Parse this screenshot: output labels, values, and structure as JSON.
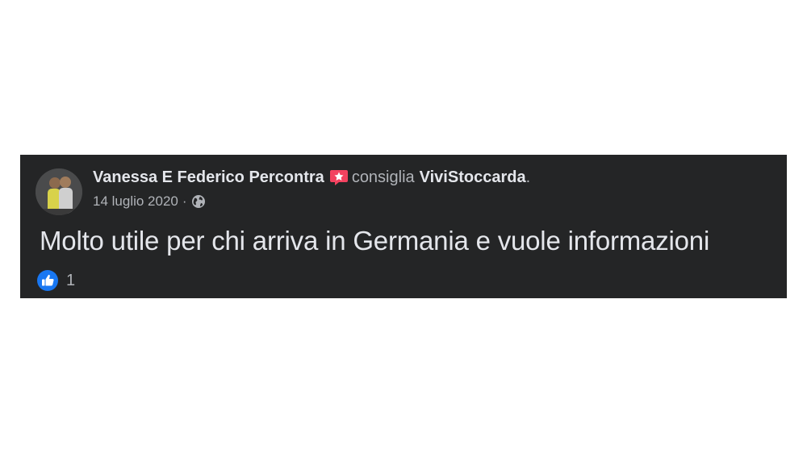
{
  "post": {
    "author": "Vanessa E Federico Percontra",
    "verb": "consiglia",
    "page_name": "ViviStoccarda",
    "period": ".",
    "date": "14 luglio 2020",
    "separator": "·",
    "text": "Molto utile per chi arriva in Germania e vuole informazioni",
    "reaction_count": "1"
  },
  "icons": {
    "recommend": "recommend-star-icon",
    "audience": "globe-icon",
    "reaction": "like-icon"
  },
  "colors": {
    "card_background": "#242526",
    "primary_text": "#e4e6eb",
    "secondary_text": "#b0b3b8",
    "recommend_badge": "#f3425f",
    "like_blue": "#1877f2"
  }
}
